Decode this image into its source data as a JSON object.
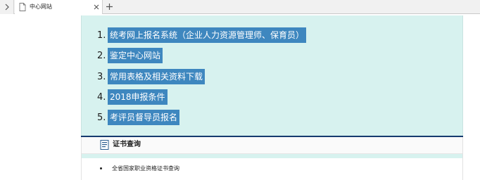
{
  "browser": {
    "tab": {
      "title": "中心网站"
    },
    "icons": {
      "sidebar_toggle": "chevron-right-icon",
      "tab_page": "page-icon",
      "tab_close": "close-icon",
      "new_tab": "plus-icon"
    }
  },
  "page": {
    "links": [
      {
        "number": "1.",
        "label": "统考网上报名系统（企业人力资源管理师、保育员）"
      },
      {
        "number": "2.",
        "label": "鉴定中心网站"
      },
      {
        "number": "3.",
        "label": "常用表格及相关资料下载"
      },
      {
        "number": "4.",
        "label": "2018申报条件"
      },
      {
        "number": "5.",
        "label": "考评员督导员报名"
      }
    ],
    "cert_section": {
      "title": "证书查询",
      "icon": "document-icon",
      "items": [
        {
          "label": "全省国家职业资格证书查询"
        }
      ]
    },
    "colors": {
      "panel_bg": "#d7f2ef",
      "link_highlight": "#3e87bf",
      "rule": "#153a6e"
    }
  }
}
